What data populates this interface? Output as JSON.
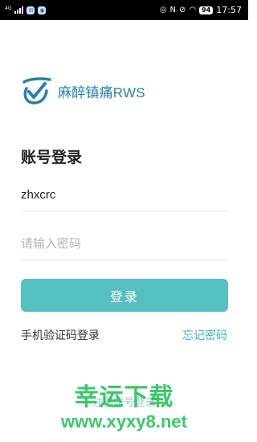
{
  "status_bar": {
    "net_type": "4G",
    "battery": "94",
    "time": "17:57"
  },
  "brand": {
    "name": "麻醉镇痛RWS",
    "colors": {
      "logo": "#2a7fae",
      "accent": "#56bfc2"
    }
  },
  "login": {
    "title": "账号登录",
    "username_value": "zhxcrc",
    "password_placeholder": "请输入密码",
    "submit_label": "登录",
    "sms_login_label": "手机验证码登录",
    "forgot_password_label": "忘记密码",
    "register_label": "注册账号登录"
  },
  "watermark": {
    "text": "幸运下载",
    "url": "www.xyxy8.net"
  }
}
